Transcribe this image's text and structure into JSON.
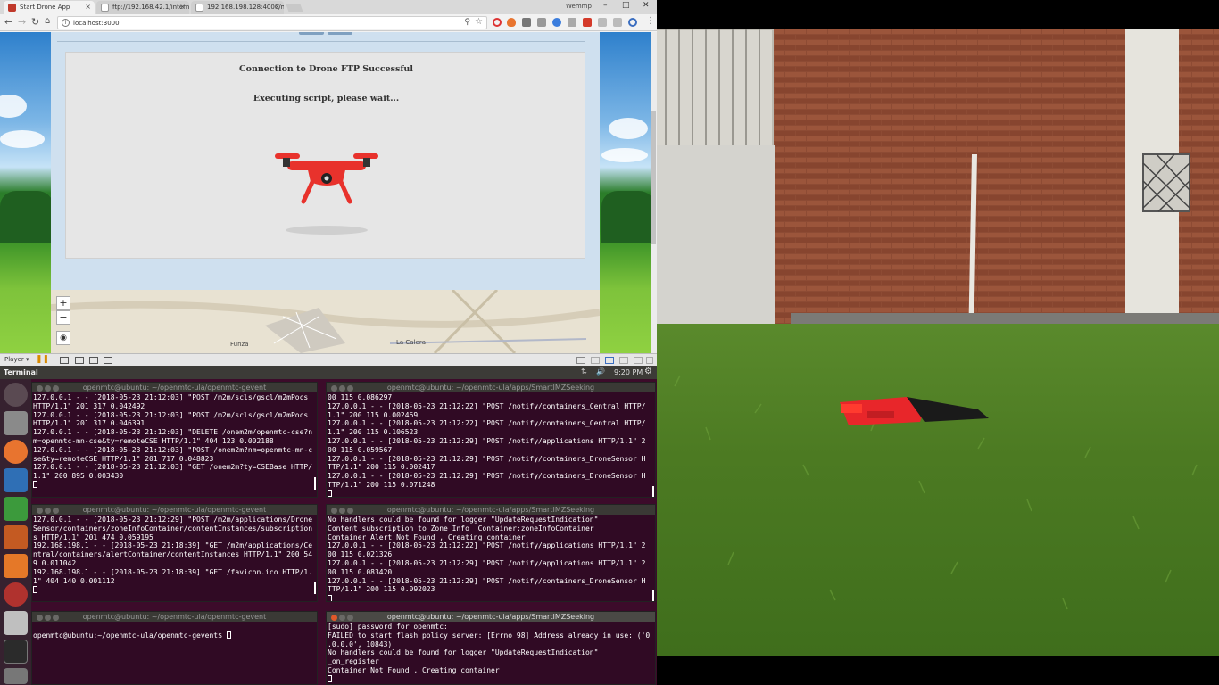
{
  "browser": {
    "tabs": [
      {
        "title": "Start Drone App"
      },
      {
        "title": "ftp://192.168.42.1/intern"
      },
      {
        "title": "192.168.198.128:4000/m"
      }
    ],
    "window_user": "Wemmp",
    "controls": {
      "minimize": "–",
      "maximize": "□",
      "close": "✕"
    },
    "address": "localhost:3000",
    "nav_icons": [
      "back-icon",
      "forward-icon",
      "reload-icon",
      "home-icon"
    ]
  },
  "page": {
    "modal_title": "Connection to Drone FTP Successful",
    "modal_status": "Executing script, please wait...",
    "map": {
      "zoom_in": "+",
      "zoom_out": "−",
      "places": [
        "Funza",
        "La Calera"
      ]
    }
  },
  "vmware": {
    "player_label": "Player ▾",
    "clock": "9:20 PM"
  },
  "ubuntu": {
    "app_title": "Terminal",
    "launcher_icons": [
      "ubuntu-dash-icon",
      "files-icon",
      "firefox-icon",
      "writer-icon",
      "calc-icon",
      "impress-icon",
      "software-center-icon",
      "settings-icon",
      "text-editor-icon",
      "terminal-icon"
    ],
    "terminals": [
      {
        "title": "openmtc@ubuntu: ~/openmtc-ula/openmtc-gevent",
        "lines": [
          "127.0.0.1 - - [2018-05-23 21:12:03] \"POST /m2m/scls/gscl/m2mPocs",
          "HTTP/1.1\" 201 317 0.042492",
          "127.0.0.1 - - [2018-05-23 21:12:03] \"POST /m2m/scls/gscl/m2mPocs",
          "HTTP/1.1\" 201 317 0.046391",
          "127.0.0.1 - - [2018-05-23 21:12:03] \"DELETE /onem2m/openmtc-cse?n",
          "m=openmtc-mn-cse&ty=remoteCSE HTTP/1.1\" 404 123 0.002188",
          "127.0.0.1 - - [2018-05-23 21:12:03] \"POST /onem2m?nm=openmtc-mn-c",
          "se&ty=remoteCSE HTTP/1.1\" 201 717 0.048823",
          "127.0.0.1 - - [2018-05-23 21:12:03] \"GET /onem2m?ty=CSEBase HTTP/",
          "1.1\" 200 895 0.003430"
        ]
      },
      {
        "title": "openmtc@ubuntu: ~/openmtc-ula/apps/SmartIMZSeeking",
        "lines": [
          "00 115 0.086297",
          "127.0.0.1 - - [2018-05-23 21:12:22] \"POST /notify/containers_Central HTTP/",
          "1.1\" 200 115 0.002469",
          "127.0.0.1 - - [2018-05-23 21:12:22] \"POST /notify/containers_Central HTTP/",
          "1.1\" 200 115 0.106523",
          "127.0.0.1 - - [2018-05-23 21:12:29] \"POST /notify/applications HTTP/1.1\" 2",
          "00 115 0.059567",
          "127.0.0.1 - - [2018-05-23 21:12:29] \"POST /notify/containers_DroneSensor H",
          "TTP/1.1\" 200 115 0.002417",
          "127.0.0.1 - - [2018-05-23 21:12:29] \"POST /notify/containers_DroneSensor H",
          "TTP/1.1\" 200 115 0.071248"
        ]
      },
      {
        "title": "openmtc@ubuntu: ~/openmtc-ula/openmtc-gevent",
        "lines": [
          "127.0.0.1 - - [2018-05-23 21:12:29] \"POST /m2m/applications/Drone",
          "Sensor/containers/zoneInfoContainer/contentInstances/subscription",
          "s HTTP/1.1\" 201 474 0.059195",
          "192.168.198.1 - - [2018-05-23 21:18:39] \"GET /m2m/applications/Ce",
          "ntral/containers/alertContainer/contentInstances HTTP/1.1\" 200 54",
          "9 0.011042",
          "192.168.198.1 - - [2018-05-23 21:18:39] \"GET /favicon.ico HTTP/1.",
          "1\" 404 140 0.001112"
        ]
      },
      {
        "title": "openmtc@ubuntu: ~/openmtc-ula/apps/SmartIMZSeeking",
        "lines": [
          "No handlers could be found for logger \"UpdateRequestIndication\"",
          "Content_subscription to Zone Info  Container:zoneInfoContainer",
          "Container Alert Not Found , Creating container",
          "127.0.0.1 - - [2018-05-23 21:12:22] \"POST /notify/applications HTTP/1.1\" 2",
          "00 115 0.021326",
          "127.0.0.1 - - [2018-05-23 21:12:29] \"POST /notify/applications HTTP/1.1\" 2",
          "00 115 0.083420",
          "127.0.0.1 - - [2018-05-23 21:12:29] \"POST /notify/containers_DroneSensor H",
          "TTP/1.1\" 200 115 0.092023"
        ]
      },
      {
        "title": "openmtc@ubuntu: ~/openmtc-ula/openmtc-gevent",
        "lines": [
          "",
          "openmtc@ubuntu:~/openmtc-ula/openmtc-gevent$ "
        ]
      },
      {
        "title": "openmtc@ubuntu: ~/openmtc-ula/apps/SmartIMZSeeking",
        "lines": [
          "[sudo] password for openmtc:",
          "FAILED to start flash policy server: [Errno 98] Address already in use: ('0",
          ".0.0.0', 10843)",
          "No handlers could be found for logger \"UpdateRequestIndication\"",
          "_on_register",
          "Container Not Found , Creating container"
        ]
      }
    ]
  }
}
